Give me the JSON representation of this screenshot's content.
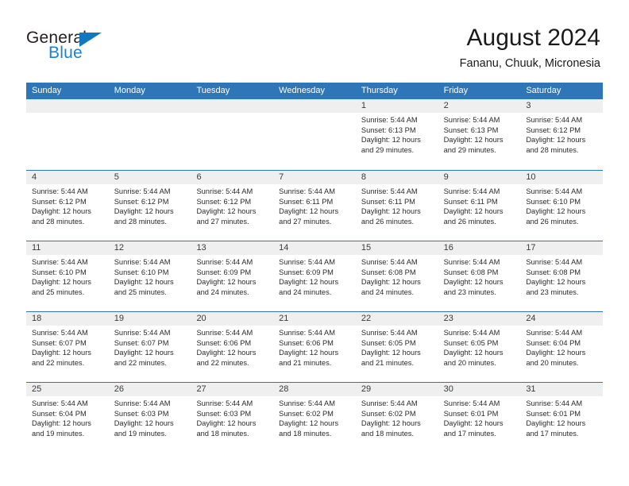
{
  "brand": {
    "name_part1": "General",
    "name_part2": "Blue",
    "accent_color": "#1b82d2",
    "triangle_color": "#1277bc"
  },
  "header": {
    "title": "August 2024",
    "subtitle": "Fananu, Chuuk, Micronesia"
  },
  "theme": {
    "header_blue": "#2f76b9",
    "day_band_gray": "#efefef"
  },
  "weekdays": [
    "Sunday",
    "Monday",
    "Tuesday",
    "Wednesday",
    "Thursday",
    "Friday",
    "Saturday"
  ],
  "weeks": [
    [
      {
        "day": "",
        "empty": true
      },
      {
        "day": "",
        "empty": true
      },
      {
        "day": "",
        "empty": true
      },
      {
        "day": "",
        "empty": true
      },
      {
        "day": "1",
        "sunrise": "Sunrise: 5:44 AM",
        "sunset": "Sunset: 6:13 PM",
        "daylight1": "Daylight: 12 hours",
        "daylight2": "and 29 minutes."
      },
      {
        "day": "2",
        "sunrise": "Sunrise: 5:44 AM",
        "sunset": "Sunset: 6:13 PM",
        "daylight1": "Daylight: 12 hours",
        "daylight2": "and 29 minutes."
      },
      {
        "day": "3",
        "sunrise": "Sunrise: 5:44 AM",
        "sunset": "Sunset: 6:12 PM",
        "daylight1": "Daylight: 12 hours",
        "daylight2": "and 28 minutes."
      }
    ],
    [
      {
        "day": "4",
        "sunrise": "Sunrise: 5:44 AM",
        "sunset": "Sunset: 6:12 PM",
        "daylight1": "Daylight: 12 hours",
        "daylight2": "and 28 minutes."
      },
      {
        "day": "5",
        "sunrise": "Sunrise: 5:44 AM",
        "sunset": "Sunset: 6:12 PM",
        "daylight1": "Daylight: 12 hours",
        "daylight2": "and 28 minutes."
      },
      {
        "day": "6",
        "sunrise": "Sunrise: 5:44 AM",
        "sunset": "Sunset: 6:12 PM",
        "daylight1": "Daylight: 12 hours",
        "daylight2": "and 27 minutes."
      },
      {
        "day": "7",
        "sunrise": "Sunrise: 5:44 AM",
        "sunset": "Sunset: 6:11 PM",
        "daylight1": "Daylight: 12 hours",
        "daylight2": "and 27 minutes."
      },
      {
        "day": "8",
        "sunrise": "Sunrise: 5:44 AM",
        "sunset": "Sunset: 6:11 PM",
        "daylight1": "Daylight: 12 hours",
        "daylight2": "and 26 minutes."
      },
      {
        "day": "9",
        "sunrise": "Sunrise: 5:44 AM",
        "sunset": "Sunset: 6:11 PM",
        "daylight1": "Daylight: 12 hours",
        "daylight2": "and 26 minutes."
      },
      {
        "day": "10",
        "sunrise": "Sunrise: 5:44 AM",
        "sunset": "Sunset: 6:10 PM",
        "daylight1": "Daylight: 12 hours",
        "daylight2": "and 26 minutes."
      }
    ],
    [
      {
        "day": "11",
        "sunrise": "Sunrise: 5:44 AM",
        "sunset": "Sunset: 6:10 PM",
        "daylight1": "Daylight: 12 hours",
        "daylight2": "and 25 minutes."
      },
      {
        "day": "12",
        "sunrise": "Sunrise: 5:44 AM",
        "sunset": "Sunset: 6:10 PM",
        "daylight1": "Daylight: 12 hours",
        "daylight2": "and 25 minutes."
      },
      {
        "day": "13",
        "sunrise": "Sunrise: 5:44 AM",
        "sunset": "Sunset: 6:09 PM",
        "daylight1": "Daylight: 12 hours",
        "daylight2": "and 24 minutes."
      },
      {
        "day": "14",
        "sunrise": "Sunrise: 5:44 AM",
        "sunset": "Sunset: 6:09 PM",
        "daylight1": "Daylight: 12 hours",
        "daylight2": "and 24 minutes."
      },
      {
        "day": "15",
        "sunrise": "Sunrise: 5:44 AM",
        "sunset": "Sunset: 6:08 PM",
        "daylight1": "Daylight: 12 hours",
        "daylight2": "and 24 minutes."
      },
      {
        "day": "16",
        "sunrise": "Sunrise: 5:44 AM",
        "sunset": "Sunset: 6:08 PM",
        "daylight1": "Daylight: 12 hours",
        "daylight2": "and 23 minutes."
      },
      {
        "day": "17",
        "sunrise": "Sunrise: 5:44 AM",
        "sunset": "Sunset: 6:08 PM",
        "daylight1": "Daylight: 12 hours",
        "daylight2": "and 23 minutes."
      }
    ],
    [
      {
        "day": "18",
        "sunrise": "Sunrise: 5:44 AM",
        "sunset": "Sunset: 6:07 PM",
        "daylight1": "Daylight: 12 hours",
        "daylight2": "and 22 minutes."
      },
      {
        "day": "19",
        "sunrise": "Sunrise: 5:44 AM",
        "sunset": "Sunset: 6:07 PM",
        "daylight1": "Daylight: 12 hours",
        "daylight2": "and 22 minutes."
      },
      {
        "day": "20",
        "sunrise": "Sunrise: 5:44 AM",
        "sunset": "Sunset: 6:06 PM",
        "daylight1": "Daylight: 12 hours",
        "daylight2": "and 22 minutes."
      },
      {
        "day": "21",
        "sunrise": "Sunrise: 5:44 AM",
        "sunset": "Sunset: 6:06 PM",
        "daylight1": "Daylight: 12 hours",
        "daylight2": "and 21 minutes."
      },
      {
        "day": "22",
        "sunrise": "Sunrise: 5:44 AM",
        "sunset": "Sunset: 6:05 PM",
        "daylight1": "Daylight: 12 hours",
        "daylight2": "and 21 minutes."
      },
      {
        "day": "23",
        "sunrise": "Sunrise: 5:44 AM",
        "sunset": "Sunset: 6:05 PM",
        "daylight1": "Daylight: 12 hours",
        "daylight2": "and 20 minutes."
      },
      {
        "day": "24",
        "sunrise": "Sunrise: 5:44 AM",
        "sunset": "Sunset: 6:04 PM",
        "daylight1": "Daylight: 12 hours",
        "daylight2": "and 20 minutes."
      }
    ],
    [
      {
        "day": "25",
        "sunrise": "Sunrise: 5:44 AM",
        "sunset": "Sunset: 6:04 PM",
        "daylight1": "Daylight: 12 hours",
        "daylight2": "and 19 minutes."
      },
      {
        "day": "26",
        "sunrise": "Sunrise: 5:44 AM",
        "sunset": "Sunset: 6:03 PM",
        "daylight1": "Daylight: 12 hours",
        "daylight2": "and 19 minutes."
      },
      {
        "day": "27",
        "sunrise": "Sunrise: 5:44 AM",
        "sunset": "Sunset: 6:03 PM",
        "daylight1": "Daylight: 12 hours",
        "daylight2": "and 18 minutes."
      },
      {
        "day": "28",
        "sunrise": "Sunrise: 5:44 AM",
        "sunset": "Sunset: 6:02 PM",
        "daylight1": "Daylight: 12 hours",
        "daylight2": "and 18 minutes."
      },
      {
        "day": "29",
        "sunrise": "Sunrise: 5:44 AM",
        "sunset": "Sunset: 6:02 PM",
        "daylight1": "Daylight: 12 hours",
        "daylight2": "and 18 minutes."
      },
      {
        "day": "30",
        "sunrise": "Sunrise: 5:44 AM",
        "sunset": "Sunset: 6:01 PM",
        "daylight1": "Daylight: 12 hours",
        "daylight2": "and 17 minutes."
      },
      {
        "day": "31",
        "sunrise": "Sunrise: 5:44 AM",
        "sunset": "Sunset: 6:01 PM",
        "daylight1": "Daylight: 12 hours",
        "daylight2": "and 17 minutes."
      }
    ]
  ]
}
